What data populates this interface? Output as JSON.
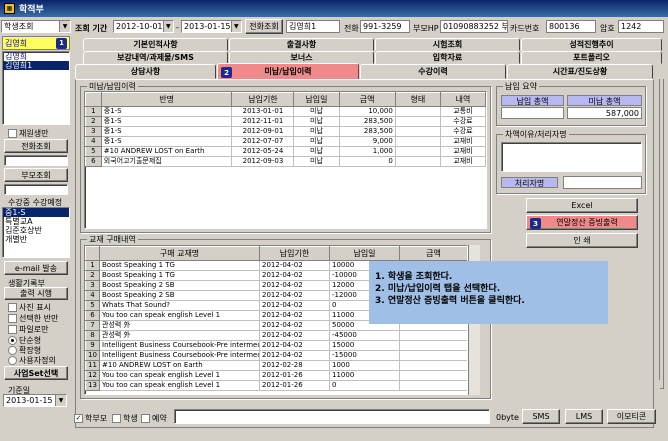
{
  "window": {
    "title": "학적부",
    "controls": [
      "_",
      "□",
      "x"
    ]
  },
  "top": {
    "student_select": "학생조회",
    "period_label": "조회 기간",
    "date_from": "2012-10-01",
    "date_to": "2013-01-15",
    "phone_search_btn": "전화조회",
    "name_value": "김영희1",
    "phone_label": "전화",
    "phone_value": "991-3259",
    "parent_hp_label": "부모HP",
    "parent_hp_value": "01090883252 부01",
    "card_label": "카드번호",
    "card_value": "800136",
    "pw_label": "암호",
    "pw_value": "1242"
  },
  "left": {
    "name_box": "김영희",
    "badge1": "1",
    "list_items": [
      "김영희",
      "김영희1"
    ],
    "reenroll_label": "재원생만",
    "phone_lookup_btn": "전화조회",
    "parent_lookup_btn": "부모조회",
    "class_label": "수강중 수강예정",
    "class_items": [
      "중1-S",
      "특별교A",
      "김준호상반",
      "개별반"
    ],
    "email_btn": "e-mail 발송",
    "record_label": "생활기록부",
    "print_btn": "출력 시행",
    "options": [
      "사진 표시",
      "선택한 반만",
      "파일로만"
    ],
    "radios": [
      "단순형",
      "확장형",
      "사용자정의"
    ],
    "set_btn": "사업Set선택",
    "base_date_label": "기준일",
    "base_date_value": "2013-01-15"
  },
  "tabs": {
    "row1": [
      "기본인적사항",
      "출결사항",
      "시험조회",
      "성적진행추이"
    ],
    "row2": [
      "보강내역/과제물/SMS",
      "보너스",
      "입학자료",
      "포트폴리오"
    ],
    "row3": [
      "상담사항",
      "미납/납입이력",
      "수강이력",
      "시간표/진도상황"
    ],
    "badge2": "2"
  },
  "payments": {
    "title": "미납/납입이력",
    "columns": [
      "반명",
      "납입기한",
      "납입일",
      "금액",
      "형태",
      "내역"
    ],
    "rows": [
      {
        "no": "1",
        "cls": "중1-S",
        "due": "2013-01-01",
        "paid": "미납",
        "amt": "10,000",
        "type": "",
        "desc": "교통비"
      },
      {
        "no": "2",
        "cls": "중1-S",
        "due": "2012-11-01",
        "paid": "미납",
        "amt": "283,500",
        "type": "",
        "desc": "수강료"
      },
      {
        "no": "3",
        "cls": "중1-S",
        "due": "2012-09-01",
        "paid": "미납",
        "amt": "283,500",
        "type": "",
        "desc": "수강료"
      },
      {
        "no": "4",
        "cls": "중1-S",
        "due": "2012-07-07",
        "paid": "미납",
        "amt": "9,000",
        "type": "",
        "desc": "교재비"
      },
      {
        "no": "5",
        "cls": "#10 ANDREW LOST on Earth",
        "due": "2012-05-24",
        "paid": "미납",
        "amt": "1,000",
        "type": "",
        "desc": "교재비"
      },
      {
        "no": "6",
        "cls": "외국어고기출문제집",
        "due": "2012-09-03",
        "paid": "미납",
        "amt": "0",
        "type": "",
        "desc": "교재비"
      }
    ]
  },
  "summary": {
    "title": "납입 요약",
    "paid_label": "납입 총액",
    "unpaid_label": "미납 총액",
    "paid_value": "",
    "unpaid_value": "587,000",
    "reason_title": "차액이유/처리자명",
    "handler_label": "처리자명",
    "excel_btn": "Excel",
    "cert_btn": "연말정산 증빙출력",
    "badge3": "3",
    "print_btn": "인 쇄"
  },
  "books": {
    "title": "교재 구매내역",
    "columns": [
      "구매 교재명",
      "납입기한",
      "납입일",
      "금액"
    ],
    "rows": [
      {
        "no": "1",
        "name": "Boost Speaking 1 TG",
        "due": "2012-04-02",
        "paid": "10000"
      },
      {
        "no": "2",
        "name": "Boost Speaking 1 TG",
        "due": "2012-04-02",
        "paid": "-10000"
      },
      {
        "no": "3",
        "name": "Boost Speaking 2 SB",
        "due": "2012-04-02",
        "paid": "12000"
      },
      {
        "no": "4",
        "name": "Boost Speaking 2 SB",
        "due": "2012-04-02",
        "paid": "-12000"
      },
      {
        "no": "5",
        "name": "Whats That Sound?",
        "due": "2012-04-02",
        "paid": "0"
      },
      {
        "no": "6",
        "name": "You too can speak english Level 1",
        "due": "2012-04-02",
        "paid": "11000"
      },
      {
        "no": "7",
        "name": "관성력 外",
        "due": "2012-04-02",
        "paid": "50000"
      },
      {
        "no": "8",
        "name": "관성력 外",
        "due": "2012-04-02",
        "paid": "-45000"
      },
      {
        "no": "9",
        "name": "Intelligent Business Coursebook-Pre intermediate Coursebo",
        "due": "2012-04-02",
        "paid": "15000"
      },
      {
        "no": "10",
        "name": "Intelligent Business Coursebook-Pre intermediate Coursebo",
        "due": "2012-04-02",
        "paid": "-15000"
      },
      {
        "no": "11",
        "name": "#10 ANDREW LOST on Earth",
        "due": "2012-02-28",
        "paid": "1000"
      },
      {
        "no": "12",
        "name": "You too can speak english Level 1",
        "due": "2012-01-26",
        "paid": "11000"
      },
      {
        "no": "13",
        "name": "You too can speak english Level 1",
        "due": "2012-01-26",
        "paid": "0"
      }
    ]
  },
  "callout": {
    "line1": "1. 학생을 조회한다.",
    "line2": "2. 미납/납입이력 탭을 선택한다.",
    "line3": "3. 연말정산 증빙출력 버튼을 클릭한다."
  },
  "bottom": {
    "recipients": [
      "학부모",
      "학생",
      "예약"
    ],
    "byte_label": "0byte",
    "sms_btn": "SMS",
    "lms_btn": "LMS",
    "emoticon_btn": "이모티콘"
  }
}
